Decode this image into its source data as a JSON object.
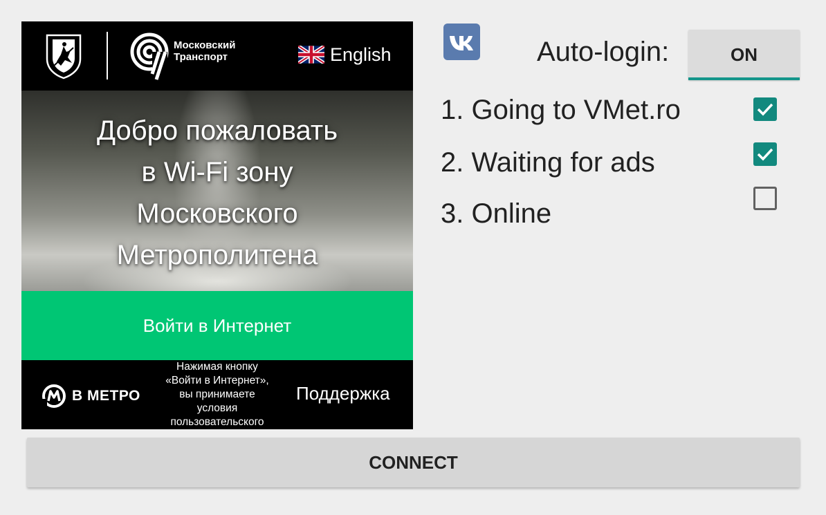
{
  "webview": {
    "brand_text_line1": "Московский",
    "brand_text_line2": "Транспорт",
    "language_label": "English",
    "welcome_lines": [
      "Добро пожаловать",
      "в Wi-Fi зону",
      "Московского",
      "Метрополитена"
    ],
    "login_button_label": "Войти в Интернет",
    "footer": {
      "vmetro_label": "В МЕТРО",
      "terms_lines": [
        "Нажимая кнопку",
        "«Войти в Интернет»,",
        "вы принимаете",
        "условия",
        "пользовательского"
      ],
      "support_label": "Поддержка"
    },
    "colors": {
      "login_button": "#00c674",
      "header_bg": "#000000"
    }
  },
  "panel": {
    "vk_icon": "vk-logo-icon",
    "autologin_label": "Auto-login:",
    "autologin_toggle": {
      "label": "ON",
      "state": true
    },
    "steps": [
      {
        "label": "1. Going to VMet.ro",
        "checked": true
      },
      {
        "label": "2. Waiting for ads",
        "checked": true
      },
      {
        "label": "3. Online",
        "checked": false
      }
    ],
    "colors": {
      "accent": "#14958a",
      "vk": "#5a7bae"
    }
  },
  "connect_button_label": "CONNECT"
}
